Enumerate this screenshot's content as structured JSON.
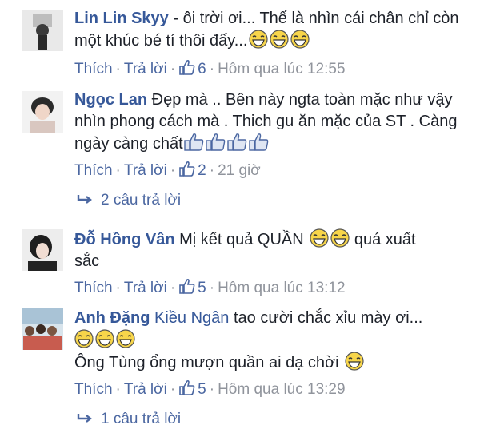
{
  "comments": [
    {
      "author": "Lin Lin Skyy",
      "text": " - ôi trời ơi... Thế là nhìn cái chân chỉ còn một khúc bé tí thôi đấy...",
      "actions": {
        "like": "Thích",
        "reply": "Trả lời",
        "likes": "6",
        "time": "Hôm qua lúc 12:55"
      }
    },
    {
      "author": "Ngọc Lan",
      "text": " Đẹp mà .. Bên này ngta toàn mặc như vậy nhìn phong cách mà . Thich gu ăn mặc của ST . Càng ngày càng chất",
      "actions": {
        "like": "Thích",
        "reply": "Trả lời",
        "likes": "2",
        "time": "21 giờ"
      },
      "replies": "2 câu trả lời"
    },
    {
      "author": "Đỗ Hồng Vân",
      "text_a": " Mị kết quả QUẦN ",
      "text_b": " quá xuất sắc",
      "actions": {
        "like": "Thích",
        "reply": "Trả lời",
        "likes": "5",
        "time": "Hôm qua lúc 13:12"
      }
    },
    {
      "author": "Anh Đặng",
      "mention": "Kiều Ngân",
      "text_a": " tao cười chắc xỉu mày ơi...",
      "text_b": "Ông Tùng ổng mượn quần ai dạ chời",
      "actions": {
        "like": "Thích",
        "reply": "Trả lời",
        "likes": "5",
        "time": "Hôm qua lúc 13:29"
      },
      "replies": "1 câu trả lời"
    }
  ],
  "colors": {
    "link": "#365899",
    "meta": "#90949c",
    "like": "#4b67a1"
  },
  "icons": [
    "laughing-emoji-icon",
    "thumbs-up-icon",
    "reply-arrow-icon"
  ]
}
